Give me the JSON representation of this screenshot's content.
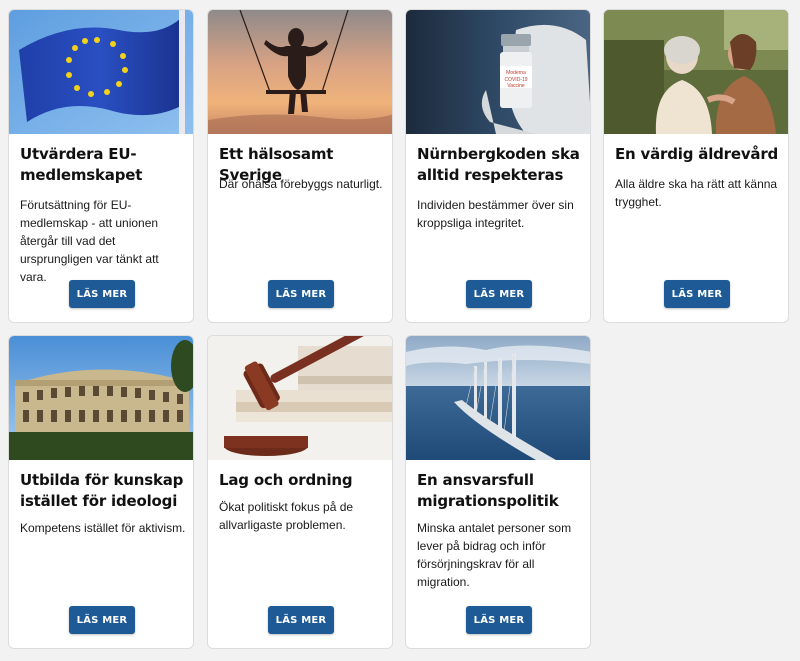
{
  "button_label": "LÄS MER",
  "cards": [
    {
      "title": "Utvärdera EU-medlemskapet",
      "description": "Förutsättning för EU-medlemskap - att unionen återgår till vad det ursprungligen var tänkt att vara.",
      "image": "eu-flag"
    },
    {
      "title": "Ett hälsosamt Sverige",
      "description": "Där ohälsa förebyggs naturligt.",
      "image": "girl-on-swing-at-sunset"
    },
    {
      "title": "Nürnbergkoden ska alltid respekteras",
      "description": "Individen bestämmer över sin kroppsliga integritet.",
      "image": "covid-vaccine-vial"
    },
    {
      "title": "En värdig äldrevård",
      "description": "Alla äldre ska ha rätt att känna trygghet.",
      "image": "elderly-woman-with-caregiver"
    },
    {
      "title": "Utbilda för kunskap istället för ideologi",
      "description": "Kompetens istället för aktivism.",
      "image": "university-building"
    },
    {
      "title": "Lag och ordning",
      "description": "Ökat politiskt fokus på de allvarligaste problemen.",
      "image": "judge-gavel-and-books"
    },
    {
      "title": "En ansvarsfull migrationspolitik",
      "description": "Minska antalet personer som lever på bidrag och inför försörjningskrav för all migration.",
      "image": "oresund-bridge"
    }
  ],
  "colors": {
    "page_background": "#f2f2f2",
    "card_background": "#ffffff",
    "button_background": "#1e5a96",
    "button_text": "#ffffff"
  }
}
